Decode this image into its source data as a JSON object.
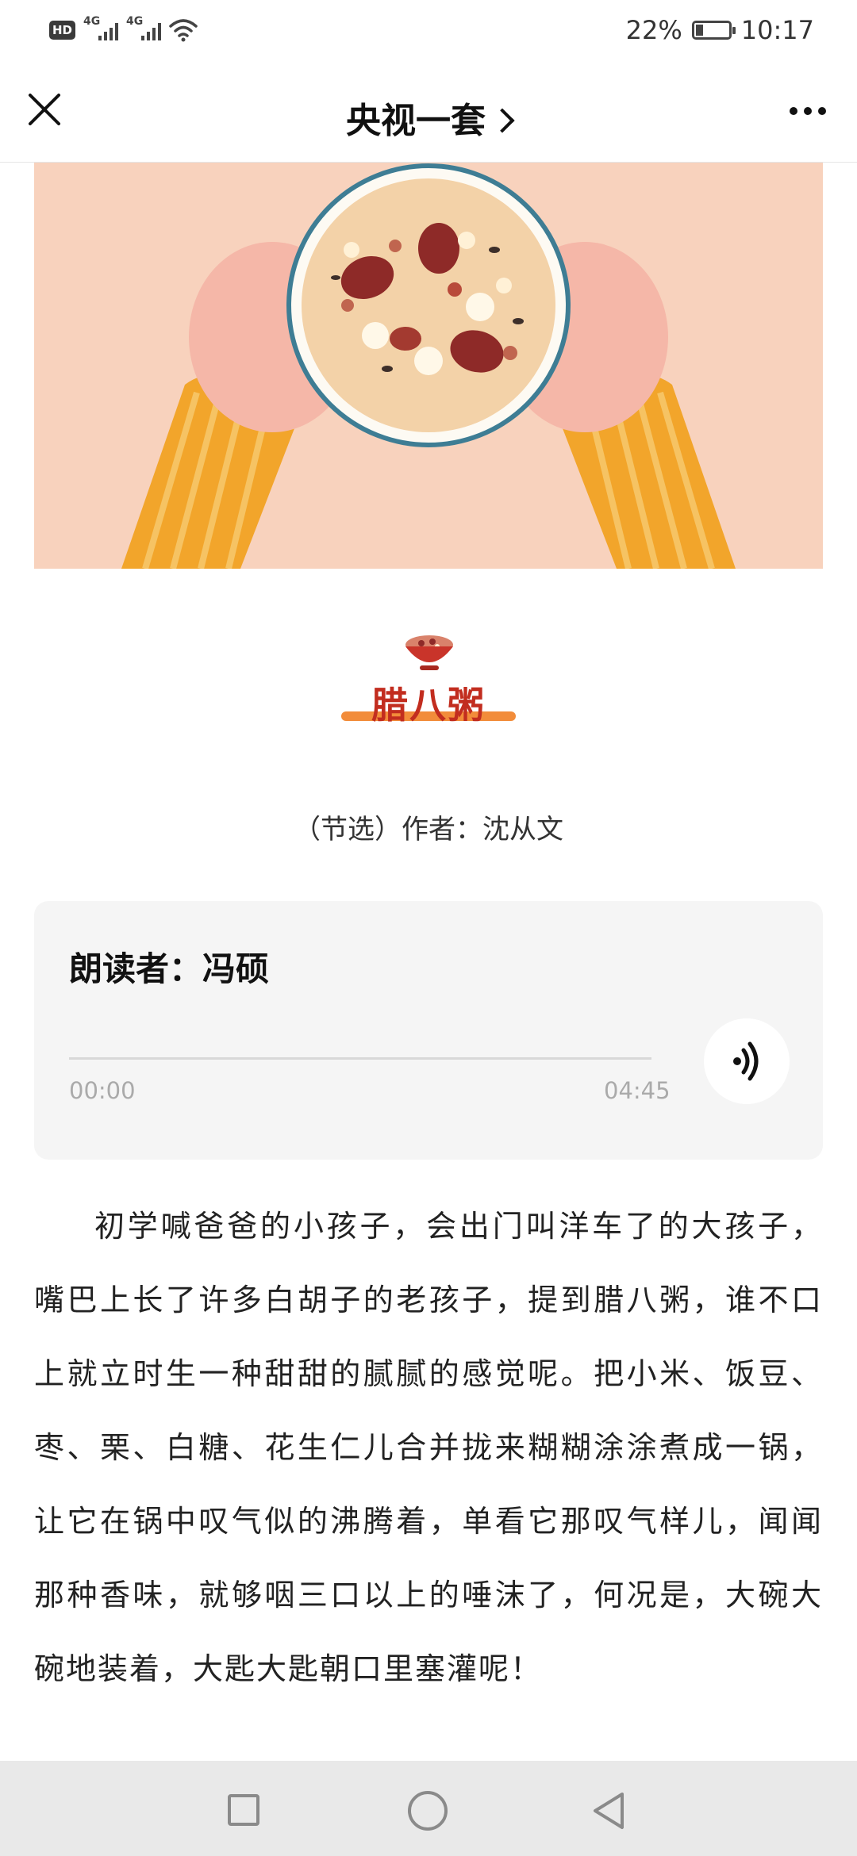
{
  "status_bar": {
    "hd_badge": "HD",
    "signal_1_label": "4G",
    "signal_2_label": "4G",
    "battery_percent": "22%",
    "battery_level": 0.22,
    "time": "10:17"
  },
  "nav": {
    "title": "央视一套"
  },
  "article": {
    "heading": "腊八粥",
    "byline": "（节选）作者：沈从文",
    "paragraph": "初学喊爸爸的小孩子，会出门叫洋车了的大孩子，嘴巴上长了许多白胡子的老孩子，提到腊八粥，谁不口上就立时生一种甜甜的腻腻的感觉呢。把小米、饭豆、枣、栗、白糖、花生仁儿合并拢来糊糊涂涂煮成一锅，让它在锅中叹气似的沸腾着，单看它那叹气样儿，闻闻那种香味，就够咽三口以上的唾沫了，何况是，大碗大碗地装着，大匙大匙朝口里塞灌呢！"
  },
  "audio": {
    "reader": "朗读者：冯硕",
    "current_time": "00:00",
    "duration": "04:45",
    "progress": 0
  },
  "colors": {
    "heading": "#c22d1f",
    "heading_underline": "#f28c3a",
    "hero_bg": "#f8d2bd",
    "sleeve": "#f2a52b",
    "card_bg": "#f5f5f5"
  },
  "icons": {
    "close": "close-icon",
    "more": "more-icon",
    "audio": "speaker-wave-icon",
    "sys_recent": "square-icon",
    "sys_home": "circle-icon",
    "sys_back": "triangle-back-icon"
  }
}
